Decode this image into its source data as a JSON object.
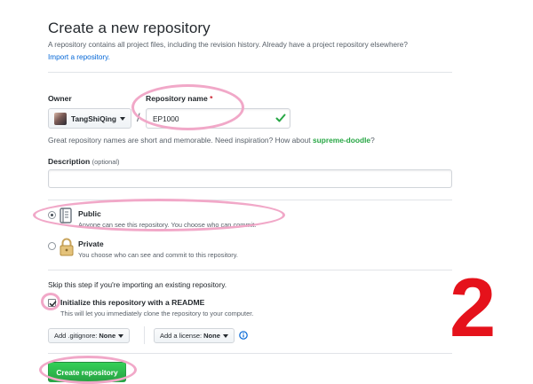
{
  "header": {
    "title": "Create a new repository",
    "subhead": "A repository contains all project files, including the revision history. Already have a project repository elsewhere?",
    "import_link": "Import a repository."
  },
  "owner": {
    "label": "Owner",
    "value": "TangShiQing",
    "separator": "/"
  },
  "repo": {
    "label": "Repository name",
    "required_mark": "*",
    "value": "EP1000"
  },
  "hint": {
    "text": "Great repository names are short and memorable. Need inspiration? How about ",
    "suggestion": "supreme-doodle",
    "end": "?"
  },
  "description": {
    "label": "Description",
    "optional": "(optional)",
    "value": ""
  },
  "visibility": {
    "public_title": "Public",
    "public_note": "Anyone can see this repository. You choose who can commit.",
    "private_title": "Private",
    "private_note": "You choose who can see and commit to this repository.",
    "selected": "public"
  },
  "init": {
    "skip_text": "Skip this step if you're importing an existing repository.",
    "readme_title": "Initialize this repository with a README",
    "readme_note": "This will let you immediately clone the repository to your computer.",
    "readme_checked": true
  },
  "options": {
    "gitignore_label": "Add .gitignore:",
    "gitignore_value": "None",
    "license_label": "Add a license:",
    "license_value": "None"
  },
  "actions": {
    "create_label": "Create repository"
  },
  "annotation": {
    "step_number": "2",
    "highlight_color": "#f1a8c8",
    "number_color": "#e5121b"
  },
  "icons": {
    "check": "check-icon",
    "public": "repo-icon",
    "private": "lock-icon",
    "info": "info-icon",
    "caret": "caret-down-icon"
  },
  "colors": {
    "primary_button": "#28a745",
    "link": "#0366d6",
    "valid_check": "#28a745"
  }
}
